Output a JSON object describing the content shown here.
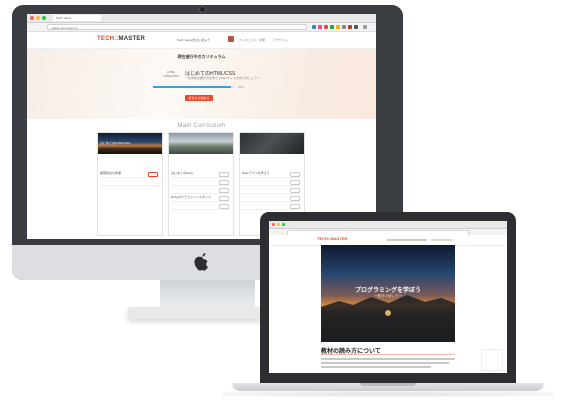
{
  "imac": {
    "browser": {
      "tab_title": "Tech::camp",
      "url": "master.tech-camp.in"
    },
    "header": {
      "logo_primary": "TECH::",
      "logo_secondary": "MASTER",
      "nav": [
        "Tech::campをはじめよう",
        "カリキュラム",
        "質問",
        "アカウント"
      ]
    },
    "hero": {
      "title": "現在進行中のカリキュラム",
      "badge_top": "HTML",
      "badge_bottom": "HTML/CSS",
      "course_name": "はじめてのHTML/CSS",
      "course_sub": "ー基本的な書き方を学んでWebサイトを作りましょうー",
      "progress": 0.95,
      "progress_label": "95%",
      "cta_label": "続きから始める"
    },
    "section_title": "Main Curriculum",
    "cards": [
      {
        "image_caption": "はじめてのHTML/CSS",
        "rows": [
          "開発環境の準備",
          "",
          "",
          "",
          ""
        ]
      },
      {
        "image_caption": "",
        "rows": [
          "はじめてのRuby",
          "",
          "",
          "Rubyのクラスとインスタンス",
          ""
        ]
      },
      {
        "image_caption": "",
        "rows": [
          "Railsアプリを作ろう",
          "",
          "",
          "",
          ""
        ]
      }
    ],
    "colors": {
      "brand": "#e84a2c",
      "progress": "#35a4d8"
    }
  },
  "macbook": {
    "header": {
      "logo": "TECH::MASTER"
    },
    "hero": {
      "title": "プログラミングを学ぼう",
      "subtitle": "ー教材の使い方ー"
    },
    "heading": "教材の読み方について"
  }
}
